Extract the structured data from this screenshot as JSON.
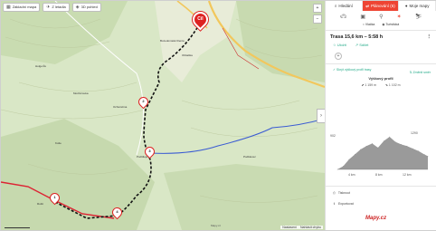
{
  "map": {
    "buttons": {
      "basic_map": "Základní mapa",
      "area": "Z letadla",
      "view_3d": "3D pohled"
    },
    "waypoints": [
      {
        "label": "Cíl"
      },
      {
        "label": "2"
      },
      {
        "label": "3"
      },
      {
        "label": "1"
      },
      {
        "label": "4"
      }
    ],
    "place_labels": [
      "Bozedomská Klenta",
      "Ochozebna",
      "Podšilejov",
      "Holgerův",
      "Obšaška",
      "Ruští",
      "Modrá louka",
      "Podklevec",
      "Kotle"
    ],
    "footer": {
      "copyright": "Mapy.cz",
      "feedback": "Nahlásit chybu",
      "settings": "Nastavení"
    }
  },
  "panel": {
    "tabs": {
      "search": "Hledání",
      "planning": "Plánování (6)",
      "my_maps": "Moje mapy"
    },
    "mode_icons": [
      "car-icon",
      "bus-icon",
      "bike-icon",
      "walk-icon",
      "ski-icon"
    ],
    "route_types": {
      "fast": "Vlačka",
      "tourist": "Turistická"
    },
    "route_title": "Trasa 15,6 km – 5:58 h",
    "actions": {
      "save": "Uložit",
      "share": "Sdílet"
    },
    "flip_direction": "Změnit směr",
    "show_profile": "Skrýt výškový profil trasy",
    "profile_title": "Výškový profil",
    "elevation": {
      "ascent": "1 159 m",
      "descent": "1 102 m",
      "max": "1290",
      "min": "902"
    },
    "profile_axis": [
      "4 km",
      "8 km",
      "12 km"
    ],
    "chart_data": {
      "type": "area",
      "x": [
        0,
        1,
        2,
        3,
        4,
        5,
        6,
        7,
        8,
        9,
        10,
        11,
        12,
        13,
        14,
        15,
        15.6
      ],
      "values": [
        902,
        940,
        1020,
        1080,
        1140,
        1180,
        1210,
        1160,
        1240,
        1290,
        1230,
        1200,
        1180,
        1150,
        1120,
        1080,
        1060
      ],
      "xlabel": "",
      "ylabel": "",
      "ylim": [
        902,
        1290
      ]
    },
    "list_items": {
      "print": "Tisknout",
      "export": "Exportovat"
    },
    "logo": "Mapy.cz"
  }
}
